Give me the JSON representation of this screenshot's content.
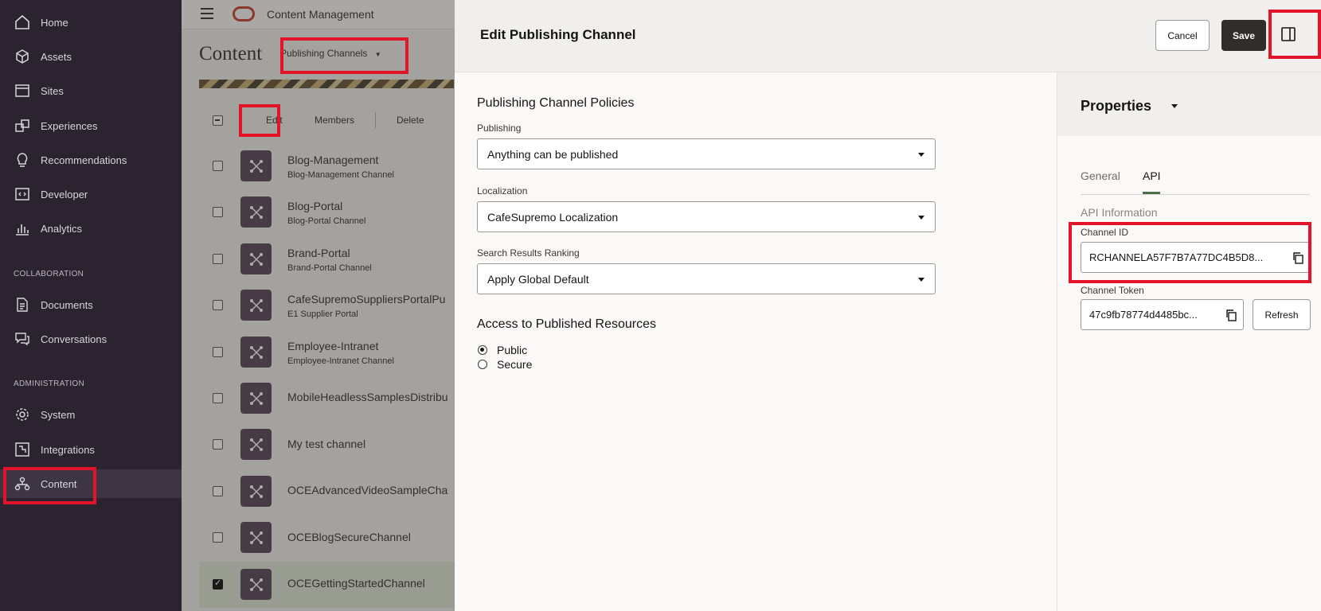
{
  "sidebar": {
    "items": [
      {
        "label": "Home",
        "icon": "home-icon"
      },
      {
        "label": "Assets",
        "icon": "cube-icon"
      },
      {
        "label": "Sites",
        "icon": "browser-icon"
      },
      {
        "label": "Experiences",
        "icon": "puzzle-icon"
      },
      {
        "label": "Recommendations",
        "icon": "lightbulb-icon"
      },
      {
        "label": "Developer",
        "icon": "code-icon"
      },
      {
        "label": "Analytics",
        "icon": "bar-chart-icon"
      }
    ],
    "collaboration_label": "COLLABORATION",
    "collaboration_items": [
      {
        "label": "Documents",
        "icon": "documents-icon"
      },
      {
        "label": "Conversations",
        "icon": "chat-icon"
      }
    ],
    "administration_label": "ADMINISTRATION",
    "administration_items": [
      {
        "label": "System",
        "icon": "gear-icon"
      },
      {
        "label": "Integrations",
        "icon": "integrations-icon"
      },
      {
        "label": "Content",
        "icon": "network-icon"
      }
    ]
  },
  "topbar": {
    "app_title": "Content Management"
  },
  "content_page": {
    "title": "Content",
    "view_selector": "Publishing Channels",
    "toolbar": {
      "edit": "Edit",
      "members": "Members",
      "delete": "Delete"
    },
    "channels": [
      {
        "name": "Blog-Management",
        "description": "Blog-Management Channel",
        "selected": false
      },
      {
        "name": "Blog-Portal",
        "description": "Blog-Portal Channel",
        "selected": false
      },
      {
        "name": "Brand-Portal",
        "description": "Brand-Portal Channel",
        "selected": false
      },
      {
        "name": "CafeSupremoSuppliersPortalPu",
        "description": "E1 Supplier Portal",
        "selected": false
      },
      {
        "name": "Employee-Intranet",
        "description": "Employee-Intranet Channel",
        "selected": false
      },
      {
        "name": "MobileHeadlessSamplesDistribu",
        "description": "",
        "selected": false
      },
      {
        "name": "My test channel",
        "description": "",
        "selected": false
      },
      {
        "name": "OCEAdvancedVideoSampleCha",
        "description": "",
        "selected": false
      },
      {
        "name": "OCEBlogSecureChannel",
        "description": "",
        "selected": false
      },
      {
        "name": "OCEGettingStartedChannel",
        "description": "",
        "selected": true
      }
    ]
  },
  "panel": {
    "title": "Edit Publishing Channel",
    "cancel_label": "Cancel",
    "save_label": "Save",
    "policies": {
      "section_title": "Publishing Channel Policies",
      "publishing_label": "Publishing",
      "publishing_value": "Anything can be published",
      "localization_label": "Localization",
      "localization_value": "CafeSupremo Localization",
      "ranking_label": "Search Results Ranking",
      "ranking_value": "Apply Global Default"
    },
    "access": {
      "section_title": "Access to Published Resources",
      "options": [
        {
          "label": "Public",
          "selected": true
        },
        {
          "label": "Secure",
          "selected": false
        }
      ]
    },
    "properties": {
      "title": "Properties",
      "tabs": [
        {
          "label": "General",
          "active": false
        },
        {
          "label": "API",
          "active": true
        }
      ],
      "api_info_label": "API Information",
      "channel_id_label": "Channel ID",
      "channel_id_value": "RCHANNELA57F7B7A77DC4B5D8...",
      "channel_token_label": "Channel Token",
      "channel_token_value": "47c9fb78774d4485bc...",
      "refresh_label": "Refresh"
    }
  },
  "colors": {
    "sidebar_bg": "#2b2430",
    "highlight": "#e3142a",
    "oracle_red": "#c74634",
    "save_bg": "#312d2a",
    "tab_accent": "#4a6f4a",
    "tile_bg": "#5b4b5e"
  }
}
